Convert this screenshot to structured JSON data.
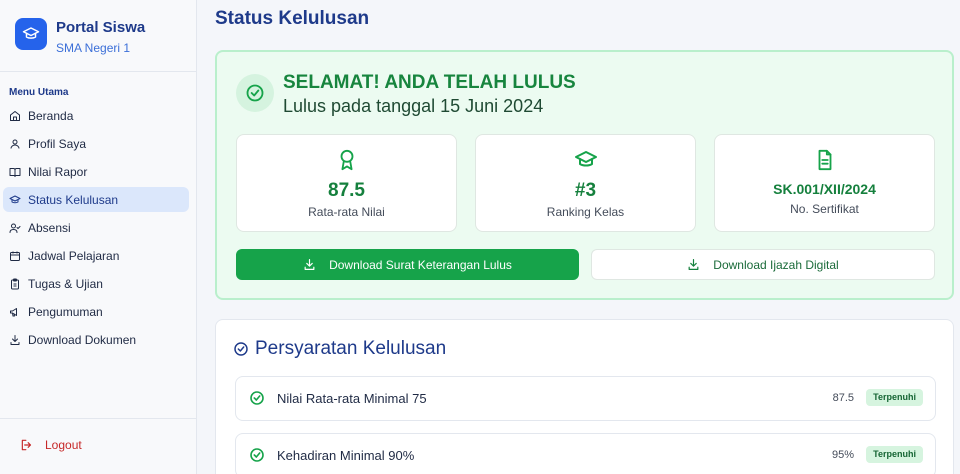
{
  "brand": {
    "title": "Portal Siswa",
    "subtitle": "SMA Negeri 1",
    "logo_icon": "graduation-cap-icon",
    "color": "#2563eb"
  },
  "sidebar": {
    "menu_title": "Menu Utama",
    "items": [
      {
        "label": "Beranda",
        "icon": "home-icon",
        "active": false
      },
      {
        "label": "Profil Saya",
        "icon": "user-icon",
        "active": false
      },
      {
        "label": "Nilai Rapor",
        "icon": "book-open-icon",
        "active": false
      },
      {
        "label": "Status Kelulusan",
        "icon": "graduation-cap-icon",
        "active": true
      },
      {
        "label": "Absensi",
        "icon": "user-check-icon",
        "active": false
      },
      {
        "label": "Jadwal Pelajaran",
        "icon": "calendar-icon",
        "active": false
      },
      {
        "label": "Tugas & Ujian",
        "icon": "clipboard-icon",
        "active": false
      },
      {
        "label": "Pengumuman",
        "icon": "megaphone-icon",
        "active": false
      },
      {
        "label": "Download Dokumen",
        "icon": "download-icon",
        "active": false
      }
    ],
    "logout_label": "Logout"
  },
  "main": {
    "page_title": "Status Kelulusan",
    "result": {
      "headline": "SELAMAT! ANDA TELAH LULUS",
      "date_text": "Lulus pada tanggal 15 Juni 2024",
      "stats": [
        {
          "value": "87.5",
          "label": "Rata-rata Nilai",
          "icon": "award-icon"
        },
        {
          "value": "#3",
          "label": "Ranking Kelas",
          "icon": "graduation-cap-icon"
        },
        {
          "value": "SK.001/XII/2024",
          "label": "No. Sertifikat",
          "icon": "document-icon"
        }
      ],
      "primary_button": "Download Surat Keterangan Lulus",
      "secondary_button": "Download Ijazah Digital"
    },
    "requirements": {
      "title": "Persyaratan Kelulusan",
      "items": [
        {
          "label": "Nilai Rata-rata Minimal 75",
          "value": "87.5",
          "status": "Terpenuhi"
        },
        {
          "label": "Kehadiran Minimal 90%",
          "value": "95%",
          "status": "Terpenuhi"
        }
      ]
    }
  },
  "colors": {
    "accent": "#1e3a8a",
    "success": "#16a34a",
    "success_bg": "#ecfbf1",
    "danger": "#c62828"
  }
}
